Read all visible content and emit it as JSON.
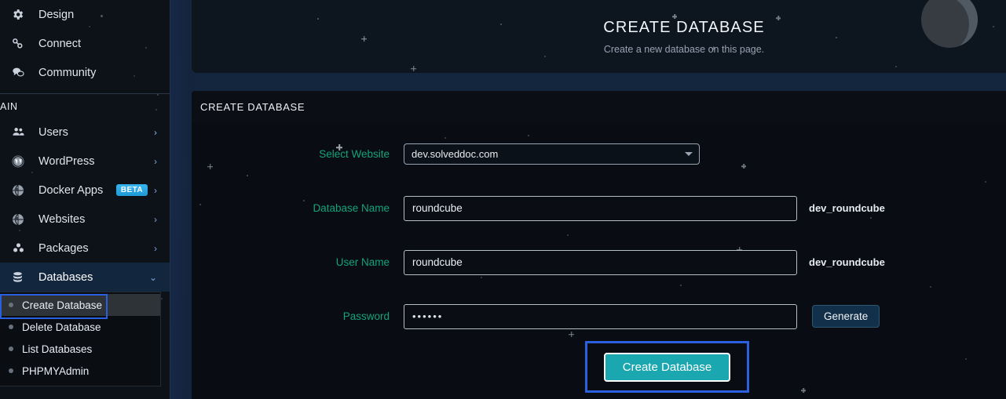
{
  "sidebar": {
    "top_items": [
      {
        "label": "Design",
        "icon": "gear-icon",
        "chevron": ""
      },
      {
        "label": "Connect",
        "icon": "link-icon",
        "chevron": ""
      },
      {
        "label": "Community",
        "icon": "chat-icon",
        "chevron": ""
      }
    ],
    "section_label": "MAIN",
    "main_items": [
      {
        "label": "Users",
        "icon": "users-icon",
        "chevron": "›",
        "badge": ""
      },
      {
        "label": "WordPress",
        "icon": "wordpress-icon",
        "chevron": "›",
        "badge": ""
      },
      {
        "label": "Docker Apps",
        "icon": "globe-icon",
        "chevron": "›",
        "badge": "BETA"
      },
      {
        "label": "Websites",
        "icon": "globe-icon",
        "chevron": "›",
        "badge": ""
      },
      {
        "label": "Packages",
        "icon": "cubes-icon",
        "chevron": "›",
        "badge": ""
      }
    ],
    "active_item": {
      "label": "Databases",
      "icon": "database-icon",
      "chevron": "⌄"
    },
    "submenu": [
      {
        "label": "Create Database"
      },
      {
        "label": "Delete Database"
      },
      {
        "label": "List Databases"
      },
      {
        "label": "PHPMYAdmin"
      }
    ]
  },
  "header": {
    "title": "CREATE DATABASE",
    "subtitle": "Create a new database on this page."
  },
  "panel": {
    "heading": "CREATE DATABASE",
    "fields": {
      "select_website": {
        "label": "Select Website",
        "value": "dev.solveddoc.com"
      },
      "database_name": {
        "label": "Database Name",
        "value": "roundcube",
        "suffix": "dev_roundcube"
      },
      "user_name": {
        "label": "User Name",
        "value": "roundcube",
        "suffix": "dev_roundcube"
      },
      "password": {
        "label": "Password",
        "value": "••••••",
        "generate_label": "Generate"
      }
    },
    "submit_label": "Create Database"
  },
  "colors": {
    "accent_teal": "#13a37a",
    "button_primary": "#1aa7b0",
    "focus_ring": "#2a5fe0",
    "badge_beta": "#35b5f0"
  }
}
